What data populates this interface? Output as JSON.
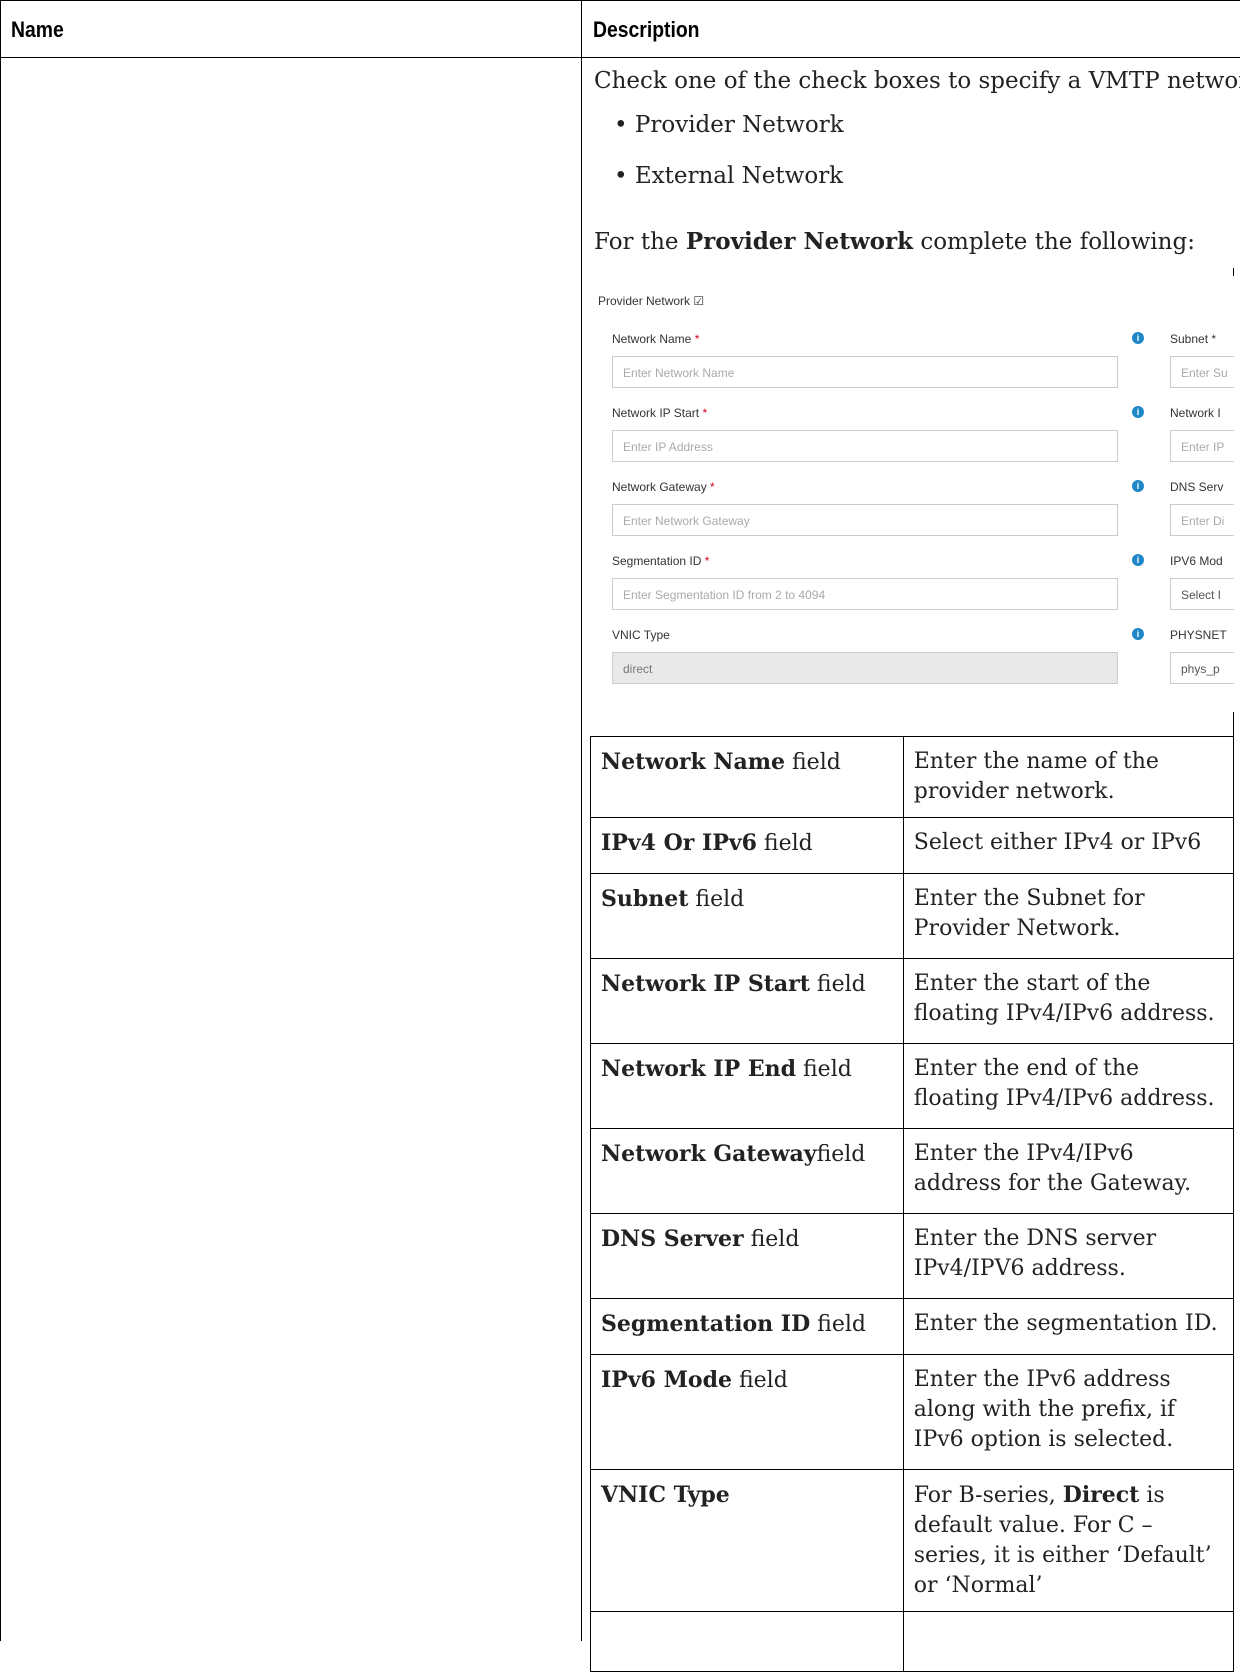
{
  "table": {
    "headers": [
      "Name",
      "Description"
    ]
  },
  "description": {
    "intro": "Check one of the check boxes to specify a VMTP network:",
    "options": [
      "• Provider Network",
      "• External Network"
    ],
    "provider_intro_pre": "For the ",
    "provider_intro_bold": "Provider Network",
    "provider_intro_post": " complete the following:"
  },
  "form": {
    "title": "Provider Network",
    "fields": [
      {
        "label": "Network Name",
        "placeholder": "Enter Network Name"
      },
      {
        "label": "Network IP Start",
        "placeholder": "Enter IP Address"
      },
      {
        "label": "Network Gateway",
        "placeholder": "Enter Network Gateway"
      },
      {
        "label": "Segmentation ID",
        "placeholder": "Enter Segmentation ID from 2 to 4094"
      },
      {
        "label": "VNIC Type",
        "value": "direct"
      }
    ],
    "right_fields": [
      {
        "label": "Subnet *",
        "placeholder": "Enter Su"
      },
      {
        "label": "Network I",
        "placeholder": "Enter IP"
      },
      {
        "label": "DNS Serv",
        "placeholder": "Enter Di"
      },
      {
        "label": "IPV6 Mod",
        "placeholder": "Select I"
      },
      {
        "label": "PHYSNET",
        "placeholder": "phys_p"
      }
    ]
  },
  "fields_table": [
    {
      "name_bold": "Network Name",
      "name_rest": " field",
      "desc": "Enter the name of the provider network."
    },
    {
      "name_bold": "IPv4 Or IPv6",
      "name_rest": " field",
      "desc": "Select either IPv4 or IPv6"
    },
    {
      "name_bold": "Subnet",
      "name_rest": " field",
      "desc": "Enter the Subnet for Provider Network."
    },
    {
      "name_bold": "Network IP Start",
      "name_rest": "  field",
      "desc": "Enter the start of the floating IPv4/IPv6 address."
    },
    {
      "name_bold": "Network IP End",
      "name_rest": "  field",
      "desc": "Enter the end of the floating IPv4/IPv6 address."
    },
    {
      "name_bold": "Network Gateway",
      "name_rest": "field",
      "desc": "Enter the IPv4/IPv6 address for the Gateway."
    },
    {
      "name_bold": "DNS Server",
      "name_rest": " field",
      "desc": "Enter the DNS server IPv4/IPV6 address."
    },
    {
      "name_bold": "Segmentation ID",
      "name_rest": "  field",
      "desc": "Enter the segmentation ID."
    },
    {
      "name_bold": "IPv6 Mode",
      "name_rest": "  field",
      "desc": "Enter the IPv6 address along with the prefix, if IPv6 option is selected."
    },
    {
      "name_bold": "VNIC Type",
      "name_rest": "",
      "desc_pre": "For B-series, ",
      "desc_bold": "Direct",
      "desc_post": " is default value. For C –series, it is either ‘Default’ or ‘Normal’"
    }
  ]
}
